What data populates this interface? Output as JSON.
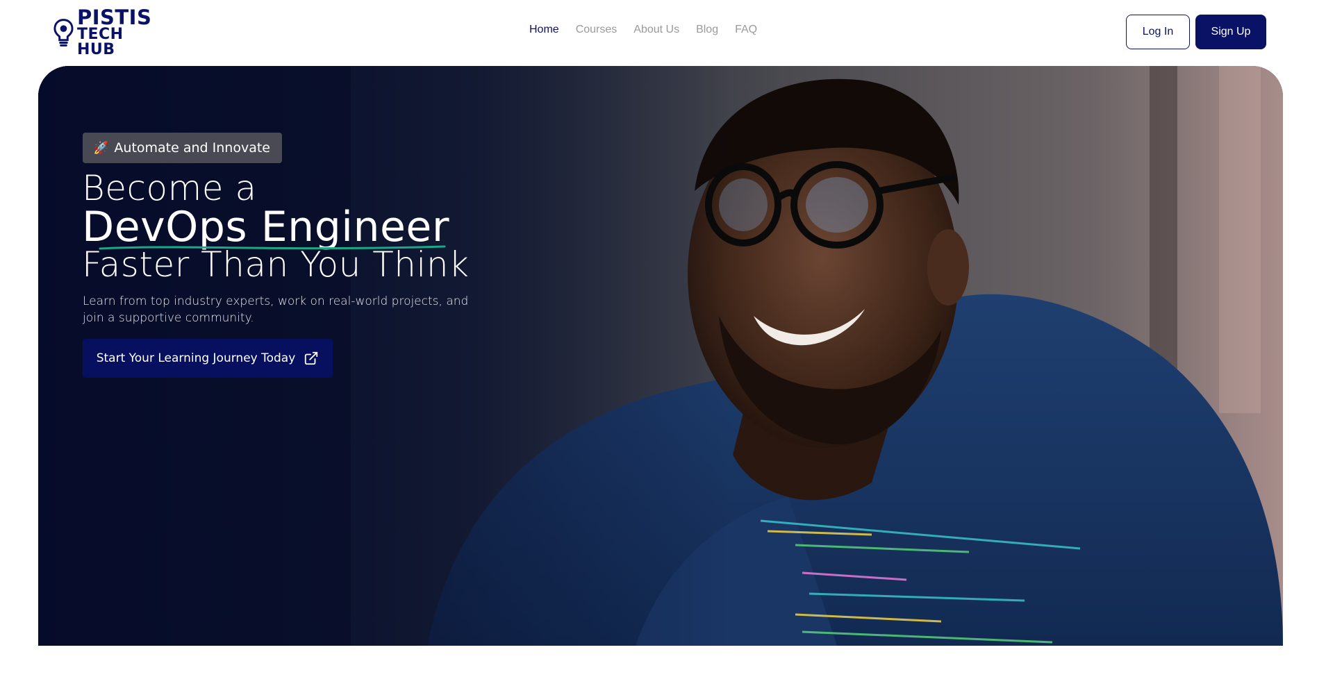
{
  "header": {
    "logo": {
      "line1": "PISTIS",
      "line2": "TECH HUB"
    },
    "nav": [
      {
        "label": "Home",
        "active": true
      },
      {
        "label": "Courses",
        "active": false
      },
      {
        "label": "About Us",
        "active": false
      },
      {
        "label": "Blog",
        "active": false
      },
      {
        "label": "FAQ",
        "active": false
      }
    ],
    "login_label": "Log In",
    "signup_label": "Sign Up"
  },
  "hero": {
    "badge": {
      "icon": "rocket-icon",
      "emoji": "🚀",
      "label": "Automate and Innovate"
    },
    "headline": {
      "line1": "Become a",
      "line2": "DevOps Engineer",
      "line3": "Faster Than You Think"
    },
    "subtext": "Learn from top industry experts, work on real-world projects, and join a supportive community.",
    "cta": {
      "label": "Start Your Learning Journey Today",
      "icon": "external-link-icon"
    }
  },
  "colors": {
    "brand": "#0a1266",
    "nav_inactive": "#9a9a9a",
    "underline_accent": "#1aa888"
  }
}
